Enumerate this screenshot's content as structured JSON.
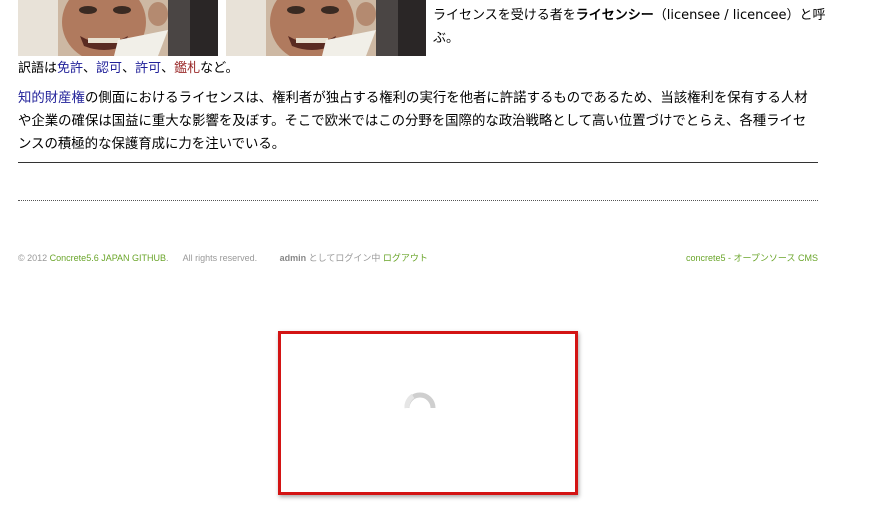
{
  "article": {
    "licensee_line_1": "ライセンスを受ける者を",
    "licensee_bold": "ライセンシー",
    "licensee_line_2": "（licensee / licencee）と呼ぶ。",
    "translations_prefix": "訳語は",
    "translation_links": [
      "免許",
      "認可",
      "許可",
      "鑑札"
    ],
    "separator": "、",
    "translations_suffix": "など。",
    "paragraph_link": "知的財産権",
    "paragraph_text": "の側面におけるライセンスは、権利者が独占する権利の実行を他者に許諾するものであるため、当該権利を保有する人材や企業の確保は国益に重大な影響を及ぼす。そこで欧米ではこの分野を国際的な政治戦略として高い位置づけでとらえ、各種ライセンスの積極的な保護育成に力を注いでいる。"
  },
  "footer": {
    "copyright_prefix": "© 2012",
    "site_link": "Concrete5.6 JAPAN GITHUB",
    "copyright_suffix": ".",
    "rights": "All rights reserved.",
    "admin_user": "admin",
    "logged_in_text": "としてログイン中",
    "logout_link": "ログアウト",
    "cms_link": "concrete5 - オープンソース CMS"
  },
  "colors": {
    "link": "#22229a",
    "visited_link": "#9a2a2a",
    "footer_link": "#6aa52a",
    "loading_border": "#d31414"
  },
  "icons": {
    "spinner": "loading-spinner-icon"
  }
}
